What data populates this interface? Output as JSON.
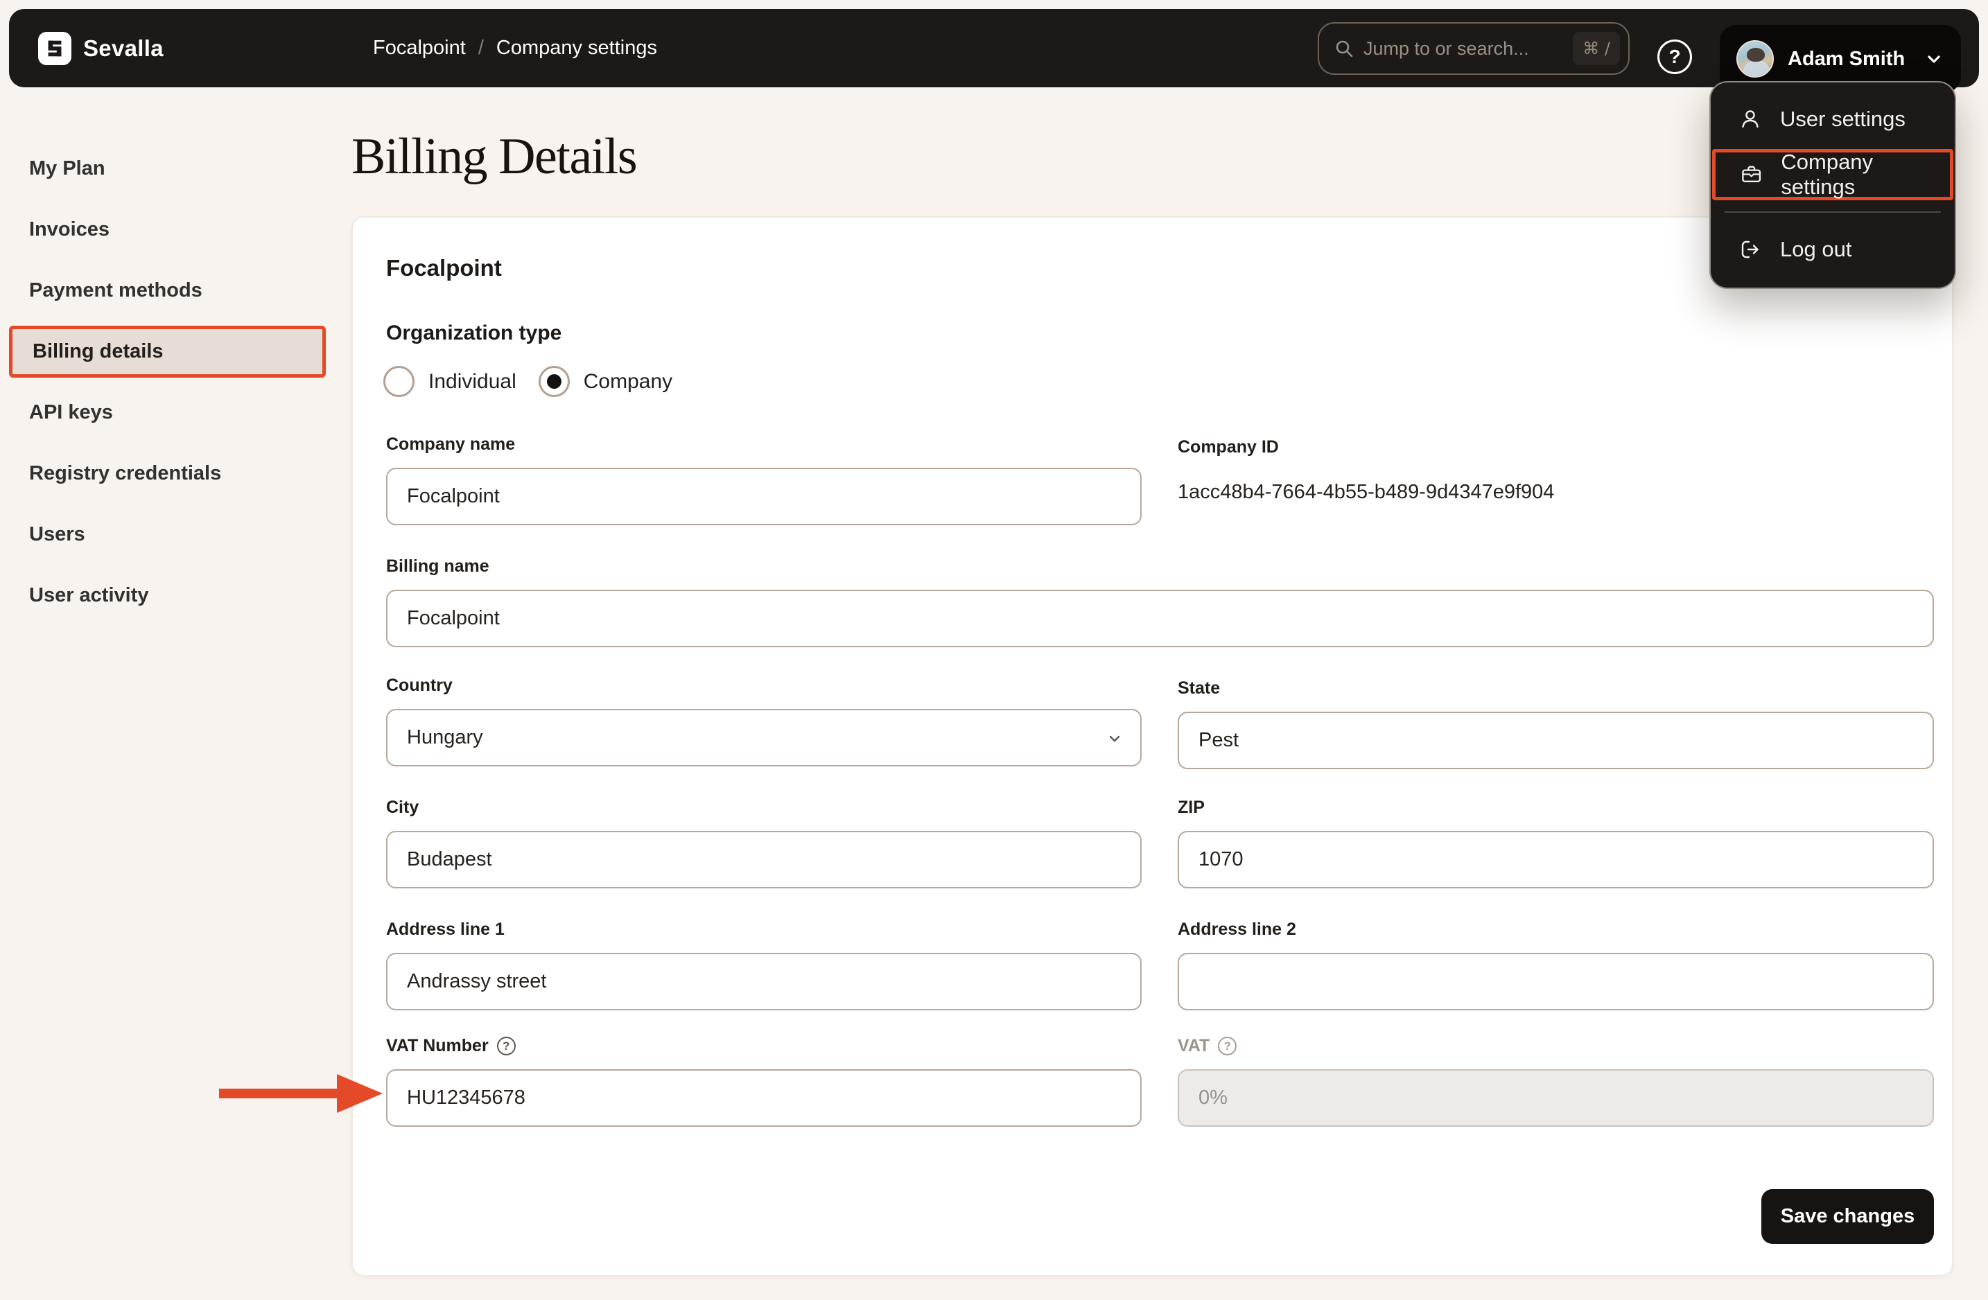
{
  "colors": {
    "page_bg": "#f8f3ee",
    "topbar_bg": "#1c1917",
    "annotation_red": "#e54a28",
    "input_border": "#b7a89a",
    "sidebar_active_bg": "#e5ddd6",
    "disabled_bg": "#edebe9",
    "save_button_bg": "#161310"
  },
  "glyphs": {
    "question": "?"
  },
  "topbar": {
    "brand": "Sevalla",
    "breadcrumb": [
      "Focalpoint",
      "Company settings"
    ],
    "breadcrumb_separator": "/",
    "search_placeholder": "Jump to or search...",
    "search_shortcut": "⌘ /",
    "user_name": "Adam Smith"
  },
  "user_menu": {
    "items": [
      {
        "label": "User settings",
        "icon": "user-icon",
        "highlighted": false
      },
      {
        "label": "Company settings",
        "icon": "briefcase-icon",
        "highlighted": true
      },
      {
        "label": "Log out",
        "icon": "logout-icon",
        "highlighted": false
      }
    ]
  },
  "sidebar": {
    "items": [
      {
        "label": "My Plan",
        "active": false
      },
      {
        "label": "Invoices",
        "active": false
      },
      {
        "label": "Payment methods",
        "active": false
      },
      {
        "label": "Billing details",
        "active": true
      },
      {
        "label": "API keys",
        "active": false
      },
      {
        "label": "Registry credentials",
        "active": false
      },
      {
        "label": "Users",
        "active": false
      },
      {
        "label": "User activity",
        "active": false
      }
    ]
  },
  "page": {
    "title": "Billing Details"
  },
  "card": {
    "heading": "Focalpoint",
    "org_type": {
      "label": "Organization type",
      "options": [
        {
          "label": "Individual",
          "selected": false
        },
        {
          "label": "Company",
          "selected": true
        }
      ]
    },
    "fields": {
      "company_name": {
        "label": "Company name",
        "value": "Focalpoint"
      },
      "company_id": {
        "label": "Company ID",
        "value": "1acc48b4-7664-4b55-b489-9d4347e9f904"
      },
      "billing_name": {
        "label": "Billing name",
        "value": "Focalpoint"
      },
      "country": {
        "label": "Country",
        "value": "Hungary"
      },
      "state": {
        "label": "State",
        "value": "Pest"
      },
      "city": {
        "label": "City",
        "value": "Budapest"
      },
      "zip": {
        "label": "ZIP",
        "value": "1070"
      },
      "address1": {
        "label": "Address line 1",
        "value": "Andrassy street"
      },
      "address2": {
        "label": "Address line 2",
        "value": ""
      },
      "vat_number": {
        "label": "VAT Number",
        "value": "HU12345678"
      },
      "vat": {
        "label": "VAT",
        "value": "0%",
        "disabled": true
      }
    },
    "save_label": "Save changes"
  }
}
